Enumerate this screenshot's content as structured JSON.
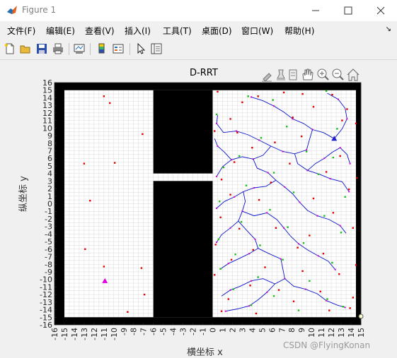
{
  "window": {
    "title": "Figure 1"
  },
  "menus": [
    "文件(F)",
    "编辑(E)",
    "查看(V)",
    "插入(I)",
    "工具(T)",
    "桌面(D)",
    "窗口(W)",
    "帮助(H)"
  ],
  "toolbar": {
    "icons": [
      "new-figure-icon",
      "open-file-icon",
      "save-icon",
      "print-icon",
      "link-plot-icon",
      "colorbar-icon",
      "legend-icon",
      "pointer-icon",
      "property-inspector-icon"
    ]
  },
  "axes_toolbar": {
    "icons": [
      "brush-icon",
      "data-tips-icon",
      "rotate-icon",
      "pan-icon",
      "zoom-in-icon",
      "zoom-out-icon",
      "home-icon"
    ]
  },
  "watermark": "CSDN @FlyingKonan",
  "chart_data": {
    "type": "scatter",
    "title": "D-RRT",
    "xlabel": "横坐标 x",
    "ylabel": "纵坐标 y",
    "xlim": [
      -16,
      15
    ],
    "ylim": [
      -16,
      16
    ],
    "xticks": [
      -16,
      -15,
      -14,
      -13,
      -12,
      -11,
      -10,
      -9,
      -8,
      -7,
      -6,
      -5,
      -4,
      -3,
      -2,
      -1,
      0,
      1,
      2,
      3,
      4,
      5,
      6,
      7,
      8,
      9,
      10,
      11,
      12,
      13,
      14,
      15
    ],
    "yticks": [
      -16,
      -15,
      -14,
      -13,
      -12,
      -11,
      -10,
      -9,
      -8,
      -7,
      -6,
      -5,
      -4,
      -3,
      -2,
      -1,
      0,
      1,
      2,
      3,
      4,
      5,
      6,
      7,
      8,
      9,
      10,
      11,
      12,
      13,
      14,
      15,
      16
    ],
    "grid": true,
    "obstacles": [
      {
        "name": "border"
      },
      {
        "name": "wall-left-upper",
        "x": [
          -6,
          0
        ],
        "y": [
          4,
          15
        ]
      },
      {
        "name": "wall-left-lower",
        "x": [
          -6,
          0
        ],
        "y": [
          -15,
          3
        ]
      }
    ],
    "start": {
      "x": 12.3,
      "y": 8.6,
      "color": "#1f1fd0"
    },
    "goal": {
      "x": -10.9,
      "y": -10.2,
      "color": "#e000e0"
    },
    "red_points": [
      [
        -11,
        14.2
      ],
      [
        -10.4,
        13.3
      ],
      [
        -7.1,
        9.2
      ],
      [
        -9.9,
        5.4
      ],
      [
        -13,
        5.3
      ],
      [
        -12.4,
        0.4
      ],
      [
        -12.9,
        -6
      ],
      [
        -11,
        -8.3
      ],
      [
        -7.2,
        -8.5
      ],
      [
        -6.9,
        -12
      ],
      [
        -8.6,
        -14.3
      ],
      [
        0.5,
        14.8
      ],
      [
        4.6,
        14.2
      ],
      [
        7.2,
        14.7
      ],
      [
        9.1,
        14.5
      ],
      [
        12.1,
        14.4
      ],
      [
        3,
        13.4
      ],
      [
        10.2,
        12.8
      ],
      [
        13.6,
        12.5
      ],
      [
        1.8,
        11.2
      ],
      [
        8.1,
        11.4
      ],
      [
        13.1,
        11
      ],
      [
        0.2,
        9.6
      ],
      [
        2.5,
        9.4
      ],
      [
        9,
        8.9
      ],
      [
        6.3,
        8.1
      ],
      [
        4,
        7.4
      ],
      [
        12.9,
        6.3
      ],
      [
        2.2,
        5.5
      ],
      [
        7.8,
        5.3
      ],
      [
        11.5,
        4.2
      ],
      [
        0.9,
        3.2
      ],
      [
        5.9,
        2.8
      ],
      [
        13.8,
        1.9
      ],
      [
        1.8,
        1.2
      ],
      [
        4.7,
        0.5
      ],
      [
        10.2,
        0.7
      ],
      [
        0.8,
        -1.8
      ],
      [
        12.2,
        -1.2
      ],
      [
        2.7,
        -3.3
      ],
      [
        6.4,
        -3.2
      ],
      [
        9.8,
        -4.2
      ],
      [
        0.3,
        -5.4
      ],
      [
        4.1,
        -6.1
      ],
      [
        8.6,
        -5.8
      ],
      [
        1.9,
        -7.4
      ],
      [
        11.2,
        -6.6
      ],
      [
        5.3,
        -8.4
      ],
      [
        0.2,
        -9.4
      ],
      [
        9.1,
        -8.9
      ],
      [
        12.8,
        -9.3
      ],
      [
        3.8,
        -10.8
      ],
      [
        6.7,
        -11.4
      ],
      [
        10.9,
        -11.6
      ],
      [
        1.6,
        -12.6
      ],
      [
        8.2,
        -12.9
      ],
      [
        13.9,
        -13.8
      ],
      [
        0.9,
        -14.2
      ],
      [
        4.4,
        -14.5
      ],
      [
        11.8,
        -14.1
      ],
      [
        14.2,
        -12.4
      ],
      [
        14.5,
        -8.1
      ],
      [
        14.2,
        -3.2
      ],
      [
        14.6,
        3.4
      ],
      [
        14.5,
        10.6
      ]
    ],
    "green_points": [
      [
        3.6,
        14.2
      ],
      [
        11.5,
        14.9
      ],
      [
        6.1,
        13.7
      ],
      [
        0.4,
        11.8
      ],
      [
        7.5,
        10.2
      ],
      [
        12.6,
        9.9
      ],
      [
        4.9,
        8.7
      ],
      [
        2.7,
        6.3
      ],
      [
        9.5,
        6.9
      ],
      [
        12.2,
        6.1
      ],
      [
        1.1,
        4.8
      ],
      [
        6.2,
        4.1
      ],
      [
        10.7,
        3.9
      ],
      [
        3.4,
        2.4
      ],
      [
        8.2,
        1.5
      ],
      [
        13.4,
        0.9
      ],
      [
        0.7,
        0.3
      ],
      [
        5.8,
        -0.8
      ],
      [
        11.3,
        -1.6
      ],
      [
        2.9,
        -2.4
      ],
      [
        7.6,
        -3.1
      ],
      [
        13,
        -3.8
      ],
      [
        0.6,
        -4.7
      ],
      [
        4.8,
        -5.5
      ],
      [
        9.2,
        -5.2
      ],
      [
        2.3,
        -6.7
      ],
      [
        7.1,
        -7.4
      ],
      [
        12.1,
        -7.8
      ],
      [
        0.8,
        -8.6
      ],
      [
        4.6,
        -9.7
      ],
      [
        9.8,
        -10.2
      ],
      [
        2.1,
        -11.3
      ],
      [
        6.2,
        -12.2
      ],
      [
        11.6,
        -12.6
      ],
      [
        3.9,
        -13.4
      ],
      [
        8.7,
        -14.1
      ],
      [
        13.2,
        -13.6
      ]
    ],
    "tree_edges": [
      [
        [
          12.3,
          8.6
        ],
        [
          11.2,
          9.4
        ],
        [
          10.1,
          9.8
        ],
        [
          9.2,
          10.6
        ],
        [
          8.1,
          11.2
        ],
        [
          7.2,
          12.1
        ],
        [
          6.2,
          12.9
        ],
        [
          5.1,
          13.6
        ],
        [
          3.9,
          14.1
        ]
      ],
      [
        [
          12.3,
          8.6
        ],
        [
          13.1,
          9.9
        ],
        [
          13.6,
          11.2
        ],
        [
          13.4,
          12.6
        ],
        [
          12.7,
          13.8
        ],
        [
          11.6,
          14.6
        ]
      ],
      [
        [
          10.1,
          9.8
        ],
        [
          9.8,
          8.5
        ],
        [
          9.5,
          7.1
        ],
        [
          8.3,
          6.6
        ],
        [
          7.1,
          6.9
        ],
        [
          5.9,
          7.6
        ],
        [
          4.7,
          8.4
        ],
        [
          3.6,
          9.1
        ],
        [
          2.4,
          9.6
        ],
        [
          1.1,
          9.4
        ],
        [
          0.4,
          10.6
        ],
        [
          0.5,
          11.7
        ]
      ],
      [
        [
          8.3,
          6.6
        ],
        [
          8.6,
          5.3
        ],
        [
          9.6,
          4.4
        ],
        [
          10.8,
          3.9
        ],
        [
          11.9,
          3.3
        ],
        [
          13.1,
          2.9
        ],
        [
          13.8,
          1.6
        ]
      ],
      [
        [
          5.9,
          7.6
        ],
        [
          5.1,
          6.4
        ],
        [
          4.1,
          5.9
        ],
        [
          3,
          6.2
        ],
        [
          1.9,
          5.8
        ],
        [
          1,
          4.9
        ],
        [
          0.4,
          3.6
        ]
      ],
      [
        [
          4.1,
          5.9
        ],
        [
          4.5,
          4.7
        ],
        [
          5.6,
          4.1
        ],
        [
          6.4,
          3.1
        ],
        [
          7.3,
          2.2
        ],
        [
          8.1,
          1.3
        ],
        [
          8.8,
          0.2
        ],
        [
          9.6,
          -0.9
        ],
        [
          10.6,
          -1.6
        ],
        [
          11.8,
          -2.1
        ],
        [
          12.9,
          -2.9
        ],
        [
          13.5,
          -3.9
        ]
      ],
      [
        [
          6.4,
          3.1
        ],
        [
          5.4,
          2.3
        ],
        [
          4.2,
          2.1
        ],
        [
          3.1,
          1.6
        ],
        [
          2.2,
          0.9
        ],
        [
          1.2,
          0.3
        ],
        [
          0.4,
          -0.6
        ]
      ],
      [
        [
          3.1,
          1.6
        ],
        [
          3.3,
          0.3
        ],
        [
          3,
          -1
        ],
        [
          2.6,
          -2.3
        ],
        [
          1.8,
          -3.2
        ],
        [
          0.9,
          -4.1
        ],
        [
          0.4,
          -5.1
        ]
      ],
      [
        [
          3,
          -1
        ],
        [
          4.2,
          -1.6
        ],
        [
          5.5,
          -1.2
        ],
        [
          6.5,
          -2.1
        ],
        [
          7.2,
          -3.2
        ],
        [
          7.9,
          -4.3
        ],
        [
          8.7,
          -5.3
        ],
        [
          9.6,
          -6.1
        ],
        [
          10.7,
          -6.9
        ],
        [
          11.7,
          -7.6
        ],
        [
          12.4,
          -8.7
        ]
      ],
      [
        [
          2.6,
          -2.3
        ],
        [
          3.5,
          -3.6
        ],
        [
          4.3,
          -4.7
        ],
        [
          4.6,
          -5.9
        ],
        [
          3.7,
          -6.6
        ],
        [
          2.6,
          -7.3
        ],
        [
          1.6,
          -7.9
        ],
        [
          0.7,
          -8.7
        ]
      ],
      [
        [
          4.6,
          -5.9
        ],
        [
          5.7,
          -6.6
        ],
        [
          6.9,
          -7.3
        ],
        [
          7.1,
          -8.6
        ],
        [
          7.3,
          -9.9
        ],
        [
          8.2,
          -10.9
        ],
        [
          9.4,
          -11.3
        ],
        [
          10.6,
          -11.9
        ],
        [
          11.5,
          -12.8
        ],
        [
          12.6,
          -13.4
        ],
        [
          13.4,
          -13.7
        ]
      ],
      [
        [
          7.3,
          -9.9
        ],
        [
          6.3,
          -10.6
        ],
        [
          5.5,
          -11.7
        ],
        [
          4.6,
          -12.7
        ],
        [
          3.7,
          -13.5
        ],
        [
          2.5,
          -13.9
        ],
        [
          1.3,
          -14.2
        ]
      ],
      [
        [
          6.3,
          -10.6
        ],
        [
          5.1,
          -9.9
        ],
        [
          3.9,
          -10.2
        ],
        [
          2.8,
          -10.9
        ],
        [
          1.8,
          -11.4
        ],
        [
          0.9,
          -12.2
        ]
      ],
      [
        [
          9.6,
          4.4
        ],
        [
          10.4,
          5.3
        ],
        [
          11.3,
          6
        ],
        [
          12.1,
          6.8
        ],
        [
          12.9,
          7.4
        ],
        [
          13.6,
          6.5
        ],
        [
          13.9,
          5.3
        ]
      ],
      [
        [
          1.9,
          5.8
        ],
        [
          1.2,
          6.8
        ],
        [
          0.5,
          7.6
        ],
        [
          0.2,
          8.6
        ]
      ]
    ]
  }
}
